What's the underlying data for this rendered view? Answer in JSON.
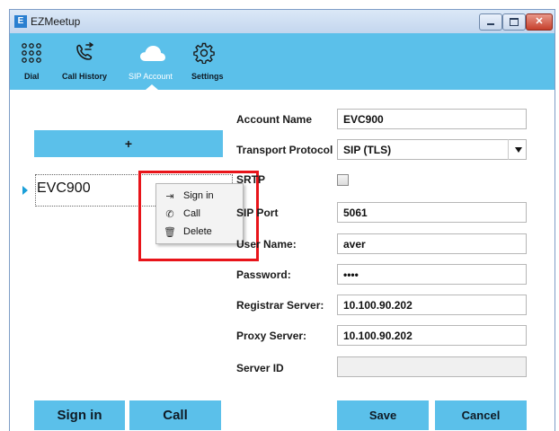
{
  "window": {
    "title": "EZMeetup",
    "app_icon_letter": "E"
  },
  "toolbar": {
    "tabs": [
      {
        "label": "Dial",
        "icon": "dialpad-icon"
      },
      {
        "label": "Call History",
        "icon": "call-history-icon"
      },
      {
        "label": "SIP Account",
        "icon": "cloud-icon",
        "active": true
      },
      {
        "label": "Settings",
        "icon": "gear-icon"
      }
    ],
    "accent_color": "#5bc0ea"
  },
  "accounts": {
    "add_label": "+",
    "items": [
      {
        "name": "EVC900",
        "selected": true
      }
    ]
  },
  "context_menu": {
    "items": [
      {
        "label": "Sign in",
        "icon": "sign-in-icon"
      },
      {
        "label": "Call",
        "icon": "phone-icon"
      },
      {
        "label": "Delete",
        "icon": "trash-icon"
      }
    ],
    "highlight_color": "#e8141a"
  },
  "form": {
    "account_name": {
      "label": "Account Name",
      "value": "EVC900"
    },
    "transport_protocol": {
      "label": "Transport Protocol",
      "value": "SIP (TLS)"
    },
    "srtp": {
      "label": "SRTP",
      "checked": false
    },
    "sip_port": {
      "label": "SIP Port",
      "value": "5061"
    },
    "user_name": {
      "label": "User Name:",
      "value": "aver"
    },
    "password": {
      "label": "Password:",
      "value": "••••"
    },
    "registrar_server": {
      "label": "Registrar Server:",
      "value": "10.100.90.202"
    },
    "proxy_server": {
      "label": "Proxy Server:",
      "value": "10.100.90.202"
    },
    "server_id": {
      "label": "Server ID",
      "value": ""
    }
  },
  "buttons": {
    "sign_in": "Sign in",
    "call": "Call",
    "save": "Save",
    "cancel": "Cancel"
  }
}
